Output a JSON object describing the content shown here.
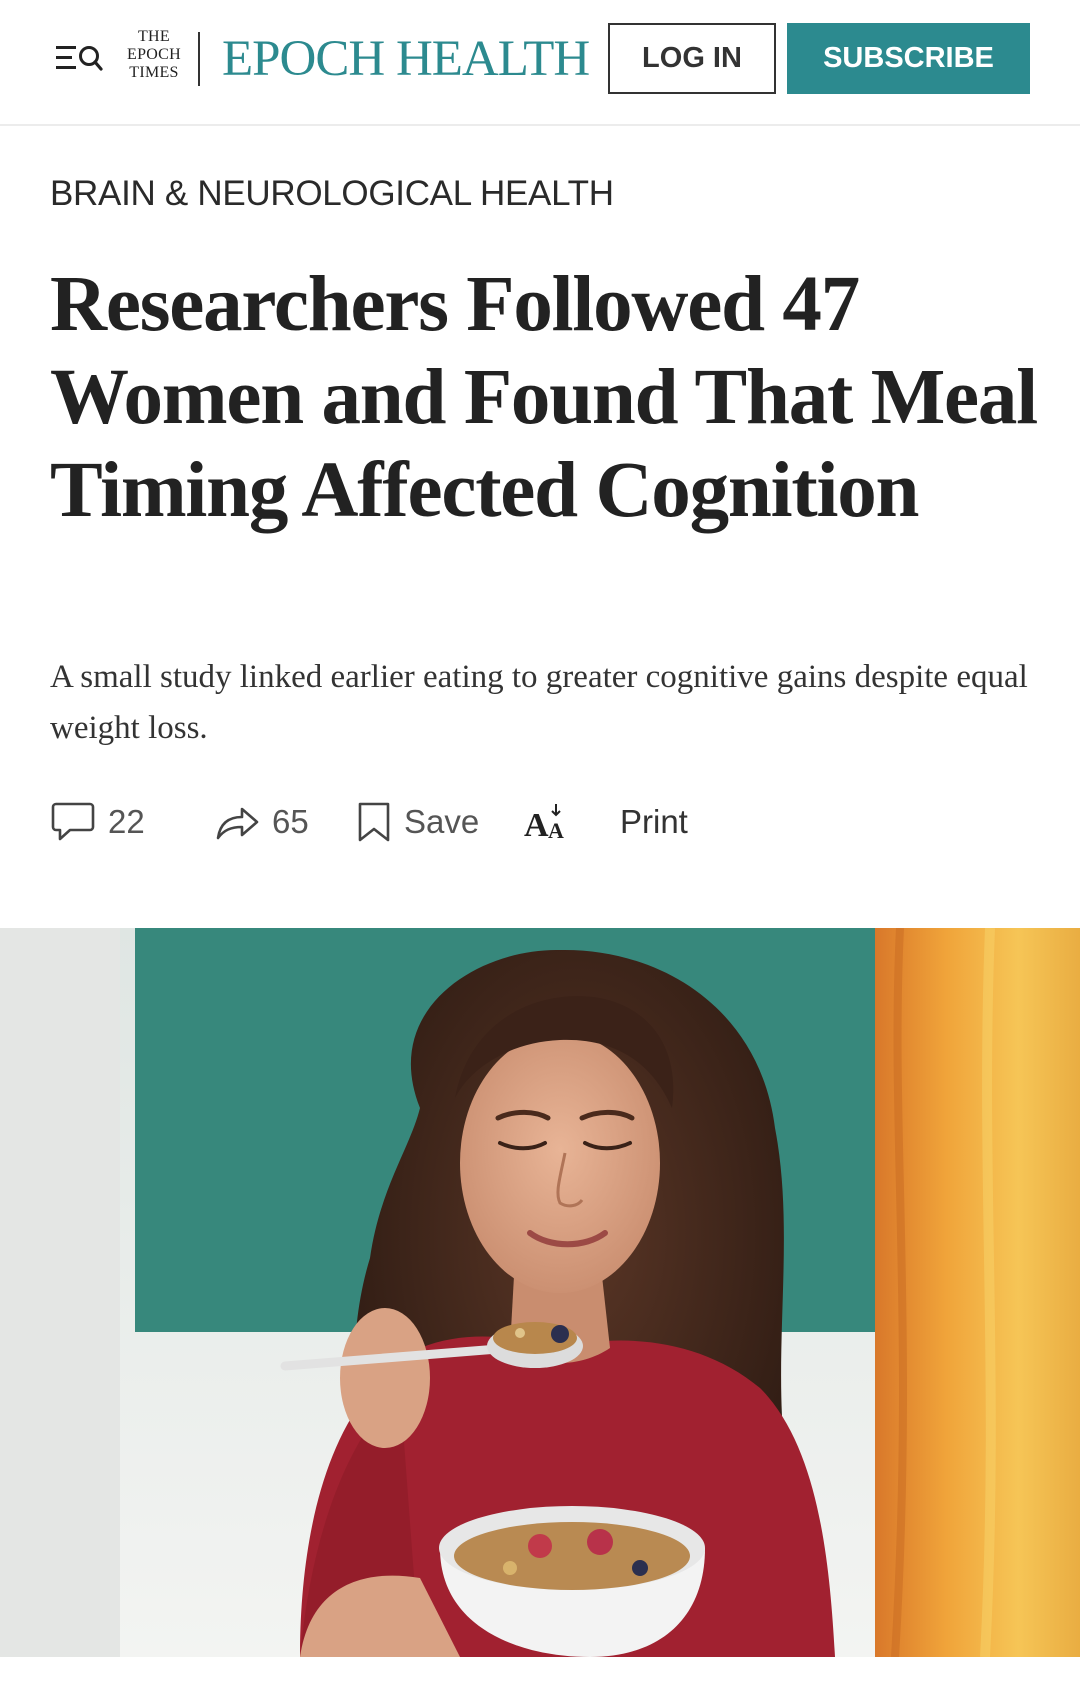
{
  "header": {
    "masthead_lines": [
      "THE",
      "EPOCH",
      "TIMES"
    ],
    "section_brand": "EPOCH HEALTH",
    "login_label": "LOG IN",
    "subscribe_label": "SUBSCRIBE",
    "brand_color": "#2c8a8f"
  },
  "article": {
    "category": "BRAIN & NEUROLOGICAL HEALTH",
    "headline": "Researchers Followed 47 Women and Found That Meal Timing Affected Cognition",
    "subheadline": "A small study linked earlier eating to greater cognitive gains despite equal weight loss."
  },
  "actions": {
    "comments": {
      "icon": "comment-icon",
      "count": "22"
    },
    "shares": {
      "icon": "share-icon",
      "count": "65"
    },
    "save": {
      "icon": "bookmark-icon",
      "label": "Save"
    },
    "font_size": {
      "icon": "font-size-icon"
    },
    "print": {
      "label": "Print"
    }
  },
  "hero_image": {
    "icon": "photo-woman-eating-granola"
  }
}
